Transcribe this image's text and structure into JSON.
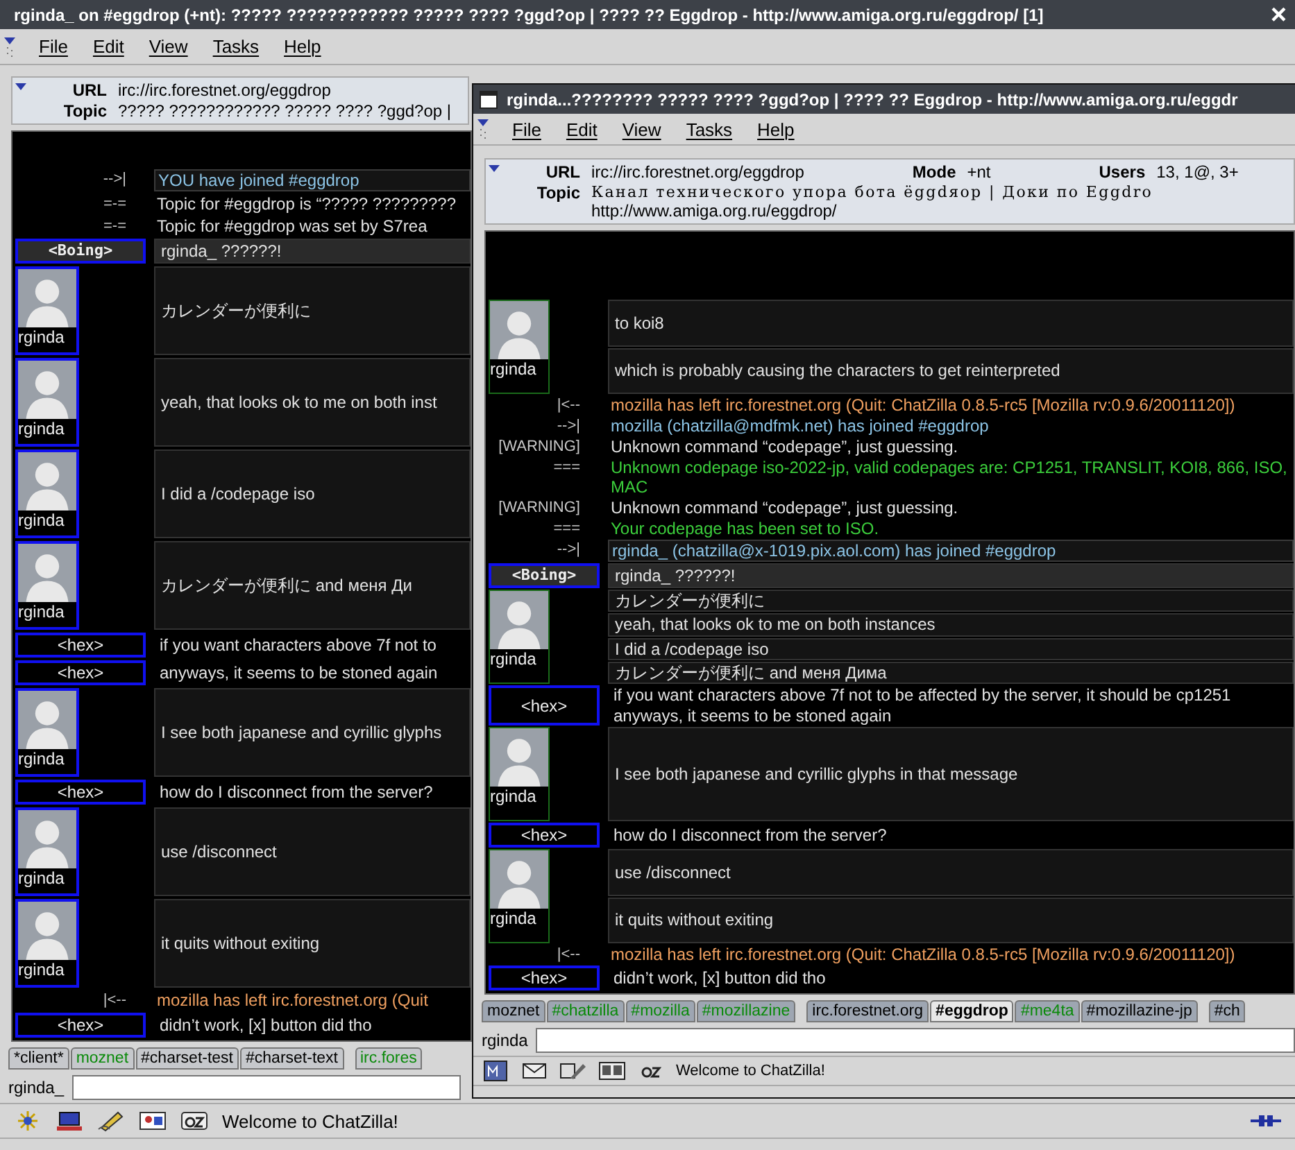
{
  "windows": [
    {
      "title": "rginda_ on #eggdrop (+nt): ????? ???????????? ????? ???? ?ggd?op | ???? ?? Eggdrop - http://www.amiga.org.ru/eggdrop/  [1]",
      "close": "×",
      "menu": [
        "File",
        "Edit",
        "View",
        "Tasks",
        "Help"
      ],
      "header": [
        {
          "fields": [
            {
              "label": "URL",
              "lines": [
                "irc://irc.forestnet.org/eggdrop"
              ]
            }
          ]
        },
        {
          "fields": [
            {
              "label": "Topic",
              "lines": [
                "????? ???????????? ????? ???? ?ggd?op |"
              ]
            }
          ]
        }
      ],
      "messages": [
        {
          "kind": "join",
          "prefix": "-->|",
          "boxed": true,
          "text": "YOU have joined #eggdrop"
        },
        {
          "kind": "notice",
          "prefix": "=-=",
          "boxed": false,
          "text": "Topic for #eggdrop is “????? ?????????"
        },
        {
          "kind": "notice",
          "prefix": "=-=",
          "boxed": false,
          "text": "Topic for #eggdrop was set by S7rea"
        },
        {
          "kind": "emphasized",
          "nick": "<Boing>",
          "mine": false,
          "lines": [
            "rginda_ ??????!"
          ]
        },
        {
          "kind": "avatar",
          "nick": "rginda",
          "mine": false,
          "lines": [
            "カレンダーが便利に"
          ]
        },
        {
          "kind": "avatar",
          "nick": "rginda",
          "mine": false,
          "lines": [
            "yeah, that looks ok to me on both inst"
          ]
        },
        {
          "kind": "avatar",
          "nick": "rginda",
          "mine": false,
          "lines": [
            "I did a /codepage iso"
          ]
        },
        {
          "kind": "avatar",
          "nick": "rginda",
          "mine": false,
          "lines": [
            "カレンダーが便利に and меня Ди"
          ]
        },
        {
          "kind": "plain",
          "nick": "<hex>",
          "mine": false,
          "lines": [
            "if you want characters above 7f not to"
          ]
        },
        {
          "kind": "plain",
          "nick": "<hex>",
          "mine": false,
          "lines": [
            "anyways, it seems to be stoned again"
          ]
        },
        {
          "kind": "avatar",
          "nick": "rginda",
          "mine": false,
          "lines": [
            "I see both japanese and cyrillic glyphs"
          ]
        },
        {
          "kind": "plain",
          "nick": "<hex>",
          "mine": false,
          "lines": [
            "how do I disconnect from the server?"
          ]
        },
        {
          "kind": "avatar",
          "nick": "rginda",
          "mine": false,
          "lines": [
            "use /disconnect"
          ]
        },
        {
          "kind": "avatar",
          "nick": "rginda",
          "mine": false,
          "lines": [
            "it quits without exiting"
          ]
        },
        {
          "kind": "quit",
          "prefix": "|<--",
          "boxed": false,
          "text": "mozilla has left irc.forestnet.org (Quit"
        },
        {
          "kind": "plain",
          "nick": "<hex>",
          "mine": false,
          "lines": [
            "didn’t work, [x] button did tho"
          ]
        }
      ],
      "tab_groups": [
        [
          {
            "label": "*client*",
            "selected": false,
            "activity": false
          },
          {
            "label": "moznet",
            "selected": false,
            "activity": true
          },
          {
            "label": "#charset-test",
            "selected": false,
            "activity": false
          },
          {
            "label": "#charset-text",
            "selected": false,
            "activity": false
          }
        ],
        [
          {
            "label": "irc.fores",
            "selected": false,
            "activity": true
          }
        ]
      ],
      "nick": "rginda_",
      "status": "Welcome to ChatZilla!"
    },
    {
      "title": "rginda...???????? ????? ???? ?ggd?op | ???? ?? Eggdrop - http://www.amiga.org.ru/eggdr",
      "menu": [
        "File",
        "Edit",
        "View",
        "Tasks",
        "Help"
      ],
      "header": [
        {
          "fields": [
            {
              "label": "URL",
              "lines": [
                "irc://irc.forestnet.org/eggdrop"
              ]
            },
            {
              "label": "Mode",
              "lines": [
                "+nt"
              ]
            },
            {
              "label": "Users",
              "lines": [
                "13, 1@, 3+"
              ]
            }
          ]
        },
        {
          "fields": [
            {
              "label": "Topic",
              "lines": [
                "Канал технического упора бота ёggdяор | Доки по Eggdro",
                "http://www.amiga.org.ru/eggdrop/"
              ]
            }
          ]
        }
      ],
      "messages": [
        {
          "kind": "avatar",
          "nick": "rginda",
          "mine": true,
          "lines": [
            "to koi8",
            "which is probably causing the characters to get reinterpreted"
          ]
        },
        {
          "kind": "quit",
          "prefix": "|<--",
          "boxed": false,
          "text": "mozilla has left irc.forestnet.org (Quit: ChatZilla 0.8.5-rc5 [Mozilla rv:0.9.6/20011120])"
        },
        {
          "kind": "join",
          "prefix": "-->|",
          "boxed": false,
          "text": "mozilla (chatzilla@mdfmk.net) has joined #eggdrop"
        },
        {
          "kind": "notice",
          "prefix": "[WARNING]",
          "boxed": false,
          "text": "Unknown command “codepage”, just guessing."
        },
        {
          "kind": "info",
          "prefix": "===",
          "boxed": false,
          "text": "Unknown codepage iso-2022-jp, valid codepages are: CP1251, TRANSLIT, KOI8, 866, ISO, MAC"
        },
        {
          "kind": "notice",
          "prefix": "[WARNING]",
          "boxed": false,
          "text": "Unknown command “codepage”, just guessing."
        },
        {
          "kind": "info",
          "prefix": "===",
          "boxed": false,
          "text": "Your codepage has been set to ISO."
        },
        {
          "kind": "join",
          "prefix": "-->|",
          "boxed": true,
          "text": "rginda_ (chatzilla@x-1019.pix.aol.com) has joined #eggdrop"
        },
        {
          "kind": "emphasized",
          "nick": "<Boing>",
          "mine": false,
          "lines": [
            "rginda_ ??????!"
          ]
        },
        {
          "kind": "avatar",
          "nick": "rginda",
          "mine": true,
          "lines": [
            "カレンダーが便利に",
            "yeah, that looks ok to me on both instances",
            "I did a /codepage iso",
            "カレンダーが便利に and меня Дима"
          ]
        },
        {
          "kind": "plain",
          "nick": "<hex>",
          "mine": false,
          "lines": [
            "if you want characters above 7f not to be affected by the server, it should be cp1251",
            "anyways, it seems to be stoned again"
          ]
        },
        {
          "kind": "avatar",
          "nick": "rginda",
          "mine": true,
          "lines": [
            "I see both japanese and cyrillic glyphs in that message"
          ]
        },
        {
          "kind": "plain",
          "nick": "<hex>",
          "mine": false,
          "lines": [
            "how do I disconnect from the server?"
          ]
        },
        {
          "kind": "avatar",
          "nick": "rginda",
          "mine": true,
          "lines": [
            "use /disconnect",
            "it quits without exiting"
          ]
        },
        {
          "kind": "quit",
          "prefix": "|<--",
          "boxed": false,
          "text": "mozilla has left irc.forestnet.org (Quit: ChatZilla 0.8.5-rc5 [Mozilla rv:0.9.6/20011120])"
        },
        {
          "kind": "plain",
          "nick": "<hex>",
          "mine": false,
          "lines": [
            "didn’t work, [x] button did tho"
          ]
        }
      ],
      "tab_groups": [
        [
          {
            "label": "moznet",
            "selected": false,
            "activity": false
          },
          {
            "label": "#chatzilla",
            "selected": false,
            "activity": true
          },
          {
            "label": "#mozilla",
            "selected": false,
            "activity": true
          },
          {
            "label": "#mozillazine",
            "selected": false,
            "activity": true
          }
        ],
        [
          {
            "label": "irc.forestnet.org",
            "selected": false,
            "activity": false
          },
          {
            "label": "#eggdrop",
            "selected": true,
            "activity": false
          },
          {
            "label": "#me4ta",
            "selected": false,
            "activity": true
          },
          {
            "label": "#mozillazine-jp",
            "selected": false,
            "activity": false
          }
        ],
        [
          {
            "label": "#ch",
            "selected": false,
            "activity": false
          }
        ]
      ],
      "nick": "rginda",
      "status": "Welcome to ChatZilla!"
    }
  ]
}
